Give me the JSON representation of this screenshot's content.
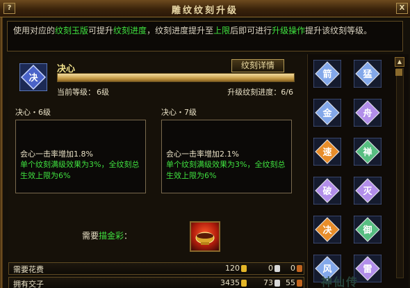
{
  "window": {
    "title": "雕纹纹刻升级",
    "help_button": "?",
    "close_button": "X"
  },
  "description": {
    "text_before_1": "使用对应的",
    "hl1": "纹刻玉版",
    "text_between_1": "可提升",
    "hl2": "纹刻进度",
    "text_between_2": "，纹刻进度提升至",
    "hl3": "上限",
    "text_between_3": "后即可进行",
    "hl4": "升级操作",
    "text_after": "提升该纹刻等级。"
  },
  "rune": {
    "icon_char": "决",
    "name": "决心",
    "detail_button": "纹刻详情",
    "current_level_label": "当前等级：",
    "current_level_value": "6级",
    "upgrade_progress_label": "升级纹刻进度：",
    "upgrade_progress_value": "6/6",
    "progress_fraction": 1.0
  },
  "current": {
    "title": "决心・6级",
    "effect": "会心一击率增加1.8%",
    "note": "单个纹刻满级效果为3%，全纹刻总生效上限为6%"
  },
  "next": {
    "title": "决心・7级",
    "effect": "会心一击率增加2.1%",
    "note": "单个纹刻满级效果为3%，全纹刻总生效上限为6%"
  },
  "requirement": {
    "prefix": "需要",
    "item_name": "描金彩",
    "suffix": "："
  },
  "costs": {
    "need_label": "需要花费",
    "need_gold": "120",
    "need_silver": "0",
    "need_bronze": "0",
    "own_label": "拥有交子",
    "own_gold": "3435",
    "own_silver": "73",
    "own_bronze": "55"
  },
  "rune_list": [
    {
      "char": "箭",
      "color": "#8fb8ff"
    },
    {
      "char": "猛",
      "color": "#8fb8ff"
    },
    {
      "char": "金",
      "color": "#8fb8ff"
    },
    {
      "char": "舟",
      "color": "#c49bff"
    },
    {
      "char": "速",
      "color": "#ff9a2a"
    },
    {
      "char": "禅",
      "color": "#5fd08a"
    },
    {
      "char": "破",
      "color": "#c49bff"
    },
    {
      "char": "灭",
      "color": "#c49bff"
    },
    {
      "char": "决",
      "color": "#ff9a2a"
    },
    {
      "char": "御",
      "color": "#5fd08a"
    },
    {
      "char": "风",
      "color": "#8fb8ff"
    },
    {
      "char": "雷",
      "color": "#c49bff"
    }
  ],
  "watermark": "神仙传"
}
